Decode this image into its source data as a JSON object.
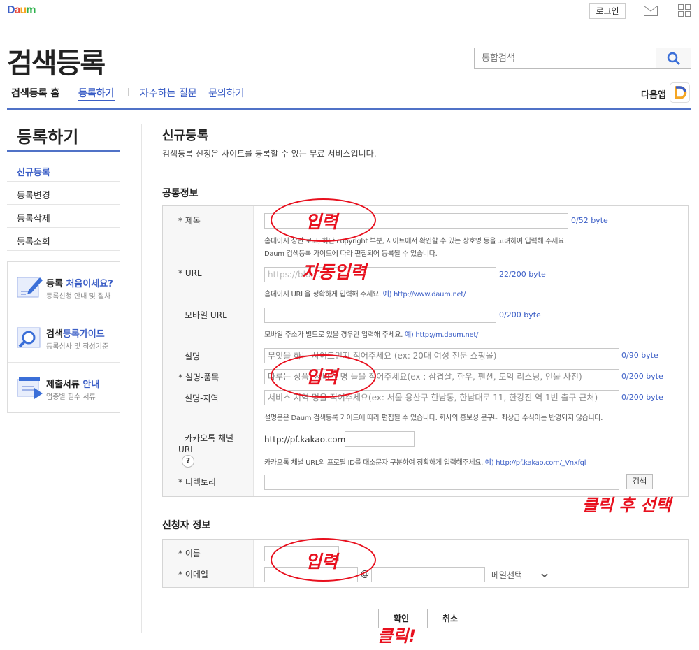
{
  "header": {
    "logo": "Daum",
    "login": "로그인",
    "page_title": "검색등록",
    "search_placeholder": "통합검색",
    "daum_app": "다음앱"
  },
  "nav": {
    "home": "검색등록 홈",
    "register": "등록하기",
    "faq": "자주하는 질문",
    "inquiry": "문의하기"
  },
  "sidebar": {
    "title": "등록하기",
    "items": [
      {
        "label": "신규등록"
      },
      {
        "label": "등록변경"
      },
      {
        "label": "등록삭제"
      },
      {
        "label": "등록조회"
      }
    ],
    "promos": [
      {
        "title_a": "등록 ",
        "title_b": "처음이세요?",
        "sub": "등록신청 안내 및 절차"
      },
      {
        "title_a": "검색",
        "title_b": "등록가이드",
        "sub": "등록심사 및 작성기준"
      },
      {
        "title_a": "제출서류 ",
        "title_b": "안내",
        "sub": "업종별 필수 서류"
      }
    ]
  },
  "main": {
    "title": "신규등록",
    "subtitle": "검색등록 신청은 사이트를 등록할 수 있는 무료 서비스입니다.",
    "common_section": "공통정보",
    "applicant_section": "신청자 정보"
  },
  "form": {
    "title_label": "* 제목",
    "title_count": "0/52 byte",
    "title_help1": "홈페이지 상단 로고, 하단 copyright 부분, 사이트에서 확인할 수 있는 상호명 등을 고려하여 입력해 주세요.",
    "title_help2": "Daum 검색등록 가이드에 따라 편집되어 등록될 수 있습니다.",
    "url_label": "* URL",
    "url_value": "https://blog...",
    "url_count": "22/200 byte",
    "url_help": "홈페이지 URL을 정확하게 입력해 주세요. ",
    "url_example": "예) http://www.daum.net/",
    "mobile_label": "모바일 URL",
    "mobile_count": "0/200 byte",
    "mobile_help": "모바일 주소가 별도로 있을 경우만 입력해 주세요. ",
    "mobile_example": "예) http://m.daum.net/",
    "desc_label": "설명",
    "desc_placeholder": "무엇을 하는 사이트인지 적어주세요 (ex: 20대 여성 전문 쇼핑몰)",
    "desc_count": "0/90 byte",
    "desc_item_label": "* 설명-품목",
    "desc_item_placeholder": "다루는 상품, 서비스 명 들을 적어주세요(ex : 삼겹살, 한우, 펜션, 토익 리스닝, 인물 사진)",
    "desc_item_count": "0/200 byte",
    "desc_region_label": "설명-지역",
    "desc_region_placeholder": "서비스 지역 명을 적어주세요(ex: 서울 용산구 한남동, 한남대로 11, 한강진 역 1번 출구 근처)",
    "desc_region_count": "0/200 byte",
    "desc_help": "설명문은 Daum 검색등록 가이드에 따라 편집될 수 있습니다. 회사의 홍보성 문구나 최상급 수식어는 반영되지 않습니다.",
    "kakao_label1": "카카오톡 채널",
    "kakao_label2": "URL",
    "kakao_q": "?",
    "kakao_prefix": "http://pf.kakao.com/",
    "kakao_help": "카카오톡 채널 URL의 프로필 ID를 대소문자 구분하여 정확하게 입력해주세요. ",
    "kakao_example": "예) http://pf.kakao.com/_Vnxfql",
    "dir_label": "* 디렉토리",
    "dir_search": "검색",
    "name_label": "* 이름",
    "email_label": "* 이메일",
    "email_at": "@",
    "email_select": "메일선택",
    "confirm": "확인",
    "cancel": "취소"
  },
  "annotations": {
    "input1": "입력",
    "auto_input": "자동입력",
    "input2": "입력",
    "click_select": "클릭 후 선택",
    "input3": "입력",
    "click": "클릭!"
  }
}
